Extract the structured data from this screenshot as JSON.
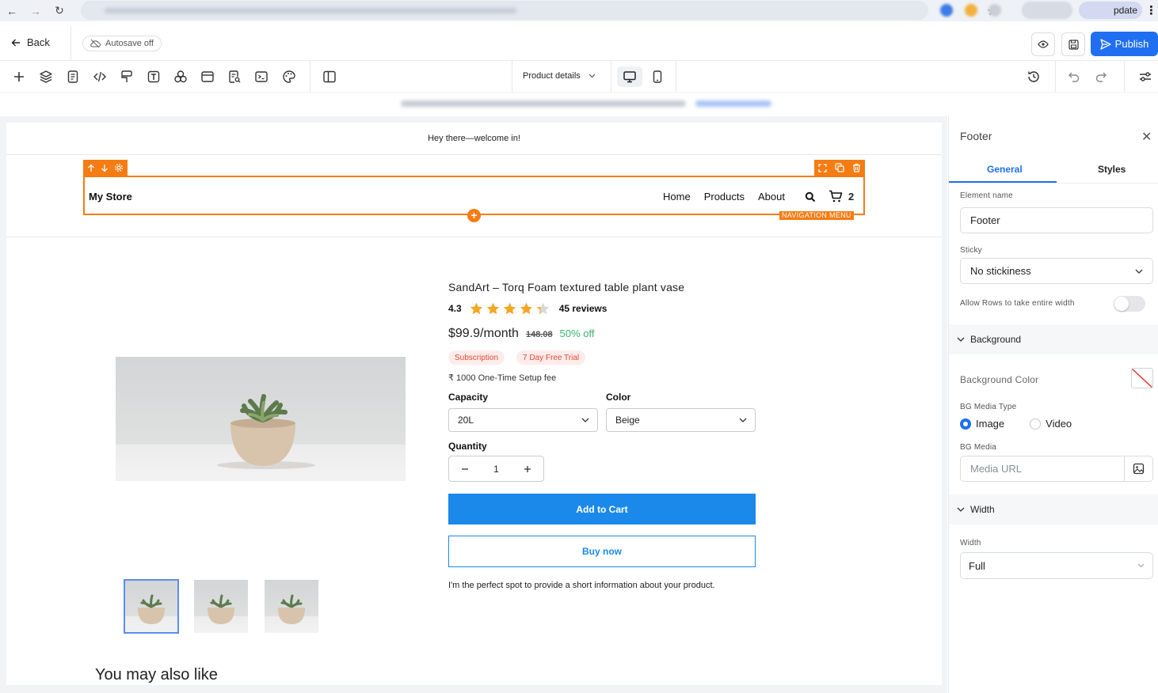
{
  "browser": {
    "update_label": "pdate",
    "nav": {
      "back_glyph": "←",
      "forward_glyph": "→",
      "reload_glyph": "↻"
    }
  },
  "topbar": {
    "back_label": "Back",
    "autosave_label": "Autosave off",
    "publish_label": "Publish"
  },
  "toolbar": {
    "page_select_value": "Product details",
    "icons": [
      "plus-icon",
      "layers-icon",
      "pages-icon",
      "code-icon",
      "paint-icon",
      "text-icon",
      "elements-icon",
      "sections-icon",
      "forms-icon",
      "terminal-icon",
      "palette-icon",
      "split-view-icon",
      "desktop-icon",
      "mobile-icon",
      "history-icon",
      "undo-icon",
      "redo-icon",
      "settings-sliders-icon"
    ]
  },
  "canvas": {
    "announcement": "Hey there—welcome in!",
    "nav": {
      "store_name": "My Store",
      "menu": [
        "Home",
        "Products",
        "About"
      ],
      "cart_count": "2",
      "selection_label": "NAVIGATION MENU"
    },
    "product": {
      "title": "SandArt – Torq Foam textured table plant vase",
      "rating": "4.3",
      "rating_stars": 4.3,
      "reviews": "45 reviews",
      "price": "$99.9/month",
      "old_price": "148.08",
      "discount": "50% off",
      "badges": [
        "Subscription",
        "7 Day Free Trial"
      ],
      "setup_fee": "₹ 1000 One-Time Setup fee",
      "capacity_label": "Capacity",
      "capacity_value": "20L",
      "color_label": "Color",
      "color_value": "Beige",
      "quantity_label": "Quantity",
      "quantity_value": "1",
      "add_to_cart": "Add to Cart",
      "buy_now": "Buy now",
      "short_info": "I'm the perfect spot to provide a short information about your product."
    },
    "also_like": "You may also like"
  },
  "panel": {
    "title": "Footer",
    "tabs": [
      "General",
      "Styles"
    ],
    "active_tab": "General",
    "element_name_label": "Element name",
    "element_name_value": "Footer",
    "sticky_label": "Sticky",
    "sticky_value": "No stickiness",
    "allow_rows_label": "Allow Rows to take entire width",
    "allow_rows_on": false,
    "background_section": "Background",
    "bg_color_label": "Background Color",
    "bg_media_type_label": "BG Media Type",
    "media_types": [
      "Image",
      "Video"
    ],
    "media_type_selected": "Image",
    "bg_media_label": "BG Media",
    "media_url_placeholder": "Media URL",
    "width_section": "Width",
    "width_label": "Width",
    "width_value": "Full"
  },
  "colors": {
    "accent": "#1f6ff0",
    "selection": "#f57c13",
    "cta": "#1b89ea",
    "discount": "#3bb36c",
    "badge_text": "#e2483d",
    "star": "#f5a623"
  }
}
